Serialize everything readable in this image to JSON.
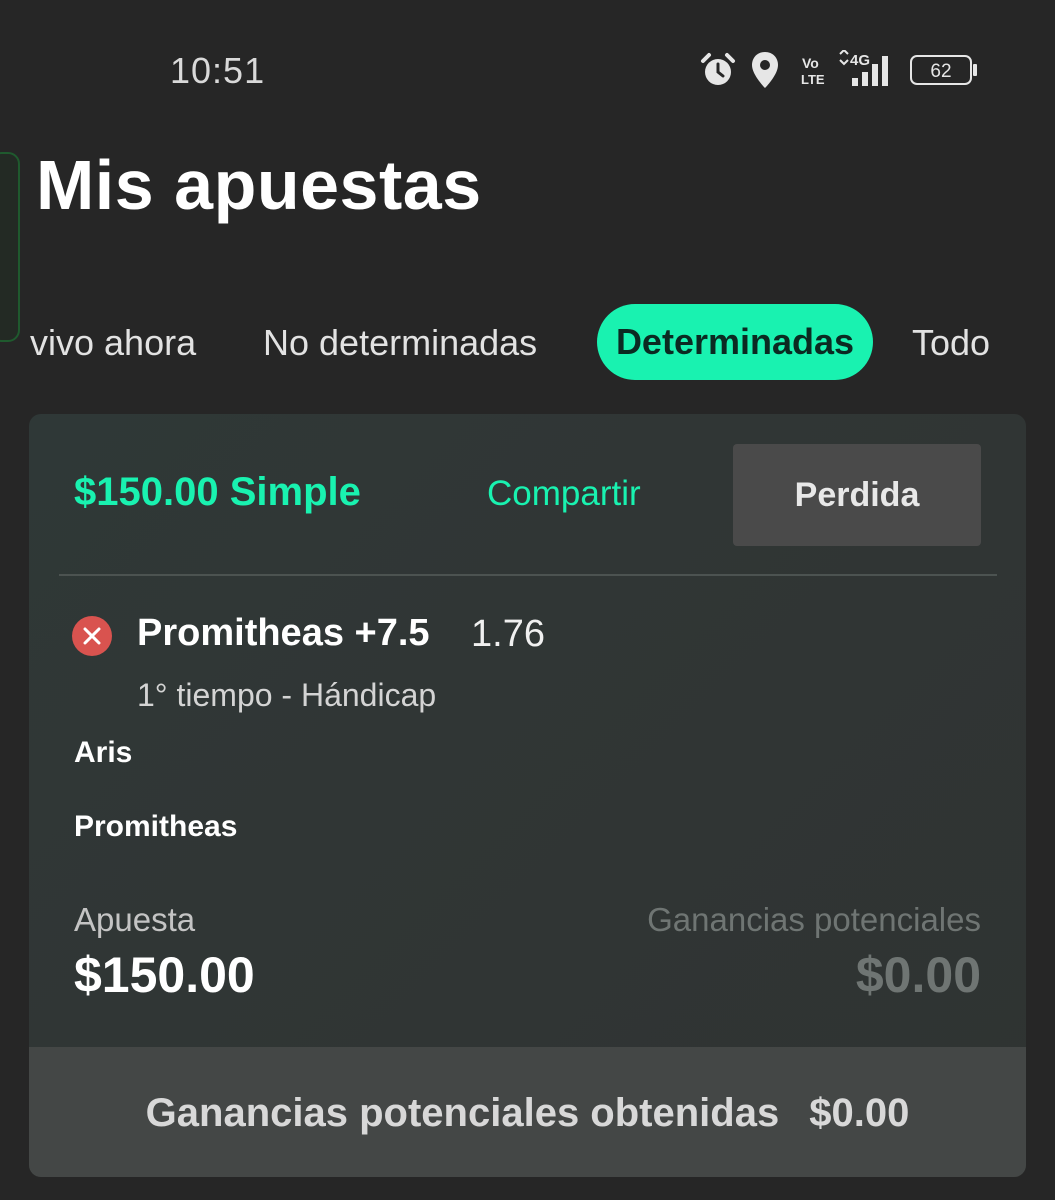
{
  "status_bar": {
    "time": "10:51",
    "icons": [
      "alarm-icon",
      "location-icon",
      "volte-icon",
      "4g-signal-icon",
      "battery-icon"
    ],
    "volte_text": "Vo LTE",
    "network": "4G",
    "battery": "62"
  },
  "page": {
    "title": "Mis apuestas"
  },
  "tabs": [
    {
      "label": "vivo ahora",
      "active": false
    },
    {
      "label": "No determinadas",
      "active": false
    },
    {
      "label": "Determinadas",
      "active": true
    },
    {
      "label": "Todo",
      "active": false
    }
  ],
  "bet": {
    "title": "$150.00 Simple",
    "share_label": "Compartir",
    "status_label": "Perdida",
    "result_icon": "close-icon",
    "selection": "Promitheas +7.5",
    "odds": "1.76",
    "market": "1° tiempo - Hándicap",
    "teams": [
      "Aris",
      "Promitheas"
    ],
    "stake_label": "Apuesta",
    "stake_value": "$150.00",
    "potential_label": "Ganancias potenciales",
    "potential_value": "$0.00",
    "footer_label": "Ganancias potenciales obtenidas",
    "footer_value": "$0.00"
  },
  "colors": {
    "background": "#262626",
    "accent": "#19f2b0",
    "lost": "#d9534f",
    "card": "#303635",
    "footer": "#444746"
  }
}
